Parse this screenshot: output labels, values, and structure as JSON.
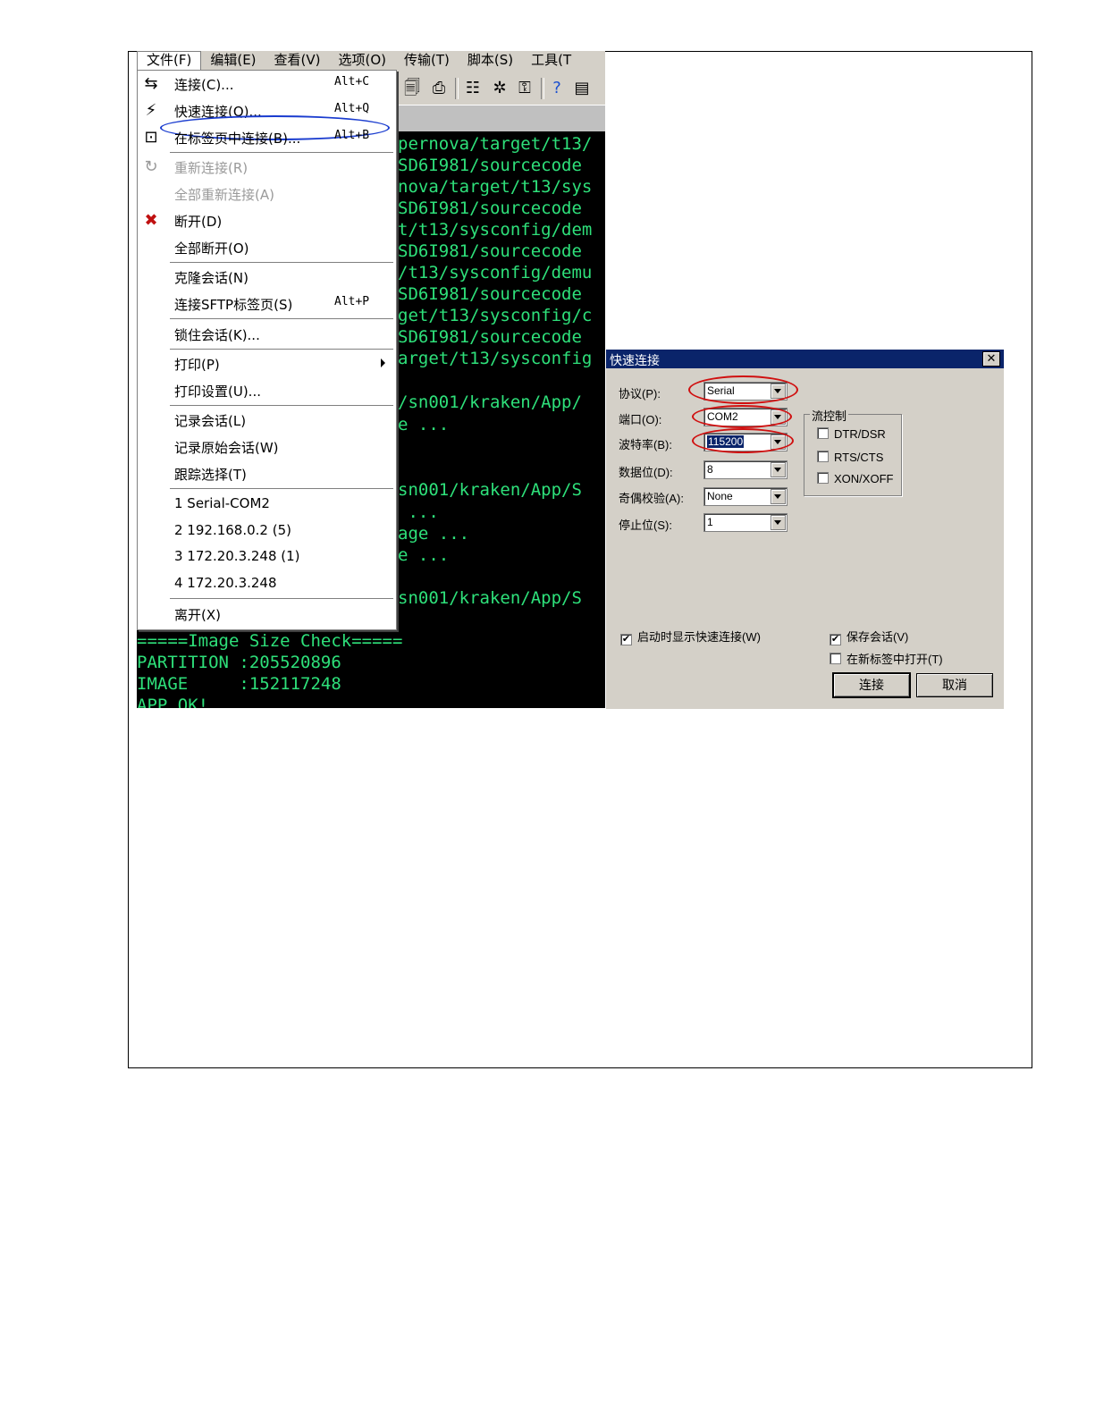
{
  "menubar": {
    "items": [
      "文件(F)",
      "编辑(E)",
      "查看(V)",
      "选项(O)",
      "传输(T)",
      "脚本(S)",
      "工具(T"
    ]
  },
  "toolbar": {
    "icons": [
      "sessions-icon",
      "print-icon",
      "properties-icon",
      "tools-icon",
      "key-icon",
      "help-icon",
      "map-icon"
    ]
  },
  "terminal": {
    "lines_right": [
      "pernova/target/t13/",
      "SD6I981/sourcecode",
      "nova/target/t13/sys",
      "SD6I981/sourcecode",
      "t/t13/sysconfig/dem",
      "SD6I981/sourcecode",
      "/t13/sysconfig/demu",
      "SD6I981/sourcecode",
      "get/t13/sysconfig/c",
      "SD6I981/sourcecode",
      "arget/t13/sysconfig",
      "",
      "/sn001/kraken/App/",
      "e ...",
      "",
      "",
      "sn001/kraken/App/S",
      " ...",
      "age ...",
      "e ...",
      "",
      "sn001/kraken/App/S"
    ],
    "lines_bottom": [
      "=====Image Size Check=====",
      "PARTITION :205520896",
      "IMAGE     :152117248",
      "APP OK!"
    ]
  },
  "file_menu": {
    "items": [
      {
        "label": "连接(C)...",
        "shortcut": "Alt+C",
        "icon": "connect-icon",
        "disabled": false
      },
      {
        "label": "快速连接(Q)...",
        "shortcut": "Alt+Q",
        "icon": "quick-connect-icon",
        "disabled": false
      },
      {
        "label": "在标签页中连接(B)...",
        "shortcut": "Alt+B",
        "icon": "connect-in-tab-icon",
        "disabled": false
      },
      {
        "label": "重新连接(R)",
        "shortcut": "",
        "icon": "reconnect-icon",
        "disabled": true
      },
      {
        "label": "全部重新连接(A)",
        "shortcut": "",
        "icon": "",
        "disabled": true
      },
      {
        "label": "断开(D)",
        "shortcut": "",
        "icon": "disconnect-icon",
        "disabled": false
      },
      {
        "label": "全部断开(O)",
        "shortcut": "",
        "icon": "",
        "disabled": false
      },
      {
        "label": "克隆会话(N)",
        "shortcut": "",
        "icon": "",
        "disabled": false
      },
      {
        "label": "连接SFTP标签页(S)",
        "shortcut": "Alt+P",
        "icon": "",
        "disabled": false
      },
      {
        "label": "锁住会话(K)...",
        "shortcut": "",
        "icon": "",
        "disabled": false
      },
      {
        "label": "打印(P)",
        "shortcut": "",
        "icon": "",
        "disabled": false
      },
      {
        "label": "打印设置(U)...",
        "shortcut": "",
        "icon": "",
        "disabled": false
      },
      {
        "label": "记录会话(L)",
        "shortcut": "",
        "icon": "",
        "disabled": false
      },
      {
        "label": "记录原始会话(W)",
        "shortcut": "",
        "icon": "",
        "disabled": false
      },
      {
        "label": "跟踪选择(T)",
        "shortcut": "",
        "icon": "",
        "disabled": false
      },
      {
        "label": "1 Serial-COM2",
        "shortcut": "",
        "icon": "",
        "disabled": false
      },
      {
        "label": "2 192.168.0.2 (5)",
        "shortcut": "",
        "icon": "",
        "disabled": false
      },
      {
        "label": "3 172.20.3.248 (1)",
        "shortcut": "",
        "icon": "",
        "disabled": false
      },
      {
        "label": "4 172.20.3.248",
        "shortcut": "",
        "icon": "",
        "disabled": false
      },
      {
        "label": "离开(X)",
        "shortcut": "",
        "icon": "",
        "disabled": false
      }
    ]
  },
  "dialog": {
    "title": "快速连接",
    "close_glyph": "✕",
    "fields": [
      {
        "label": "协议(P):",
        "value": "Serial"
      },
      {
        "label": "端口(O):",
        "value": "COM2"
      },
      {
        "label": "波特率(B):",
        "value": "115200"
      },
      {
        "label": "数据位(D):",
        "value": "8"
      },
      {
        "label": "奇偶校验(A):",
        "value": "None"
      },
      {
        "label": "停止位(S):",
        "value": "1"
      }
    ],
    "flow_control": {
      "label": "流控制",
      "options": [
        {
          "label": "DTR/DSR",
          "checked": false
        },
        {
          "label": "RTS/CTS",
          "checked": false
        },
        {
          "label": "XON/XOFF",
          "checked": false
        }
      ]
    },
    "show_on_startup": {
      "label": "启动时显示快速连接(W)",
      "checked": true
    },
    "save_session": {
      "label": "保存会话(V)",
      "checked": true
    },
    "open_in_tab": {
      "label": "在新标签中打开(T)",
      "checked": false
    },
    "connect_label": "连接",
    "cancel_label": "取消",
    "highlight_color": "#d01010"
  },
  "menu_highlight_color": "#1a3ccf",
  "terminal_text_color": "#2ee07a"
}
